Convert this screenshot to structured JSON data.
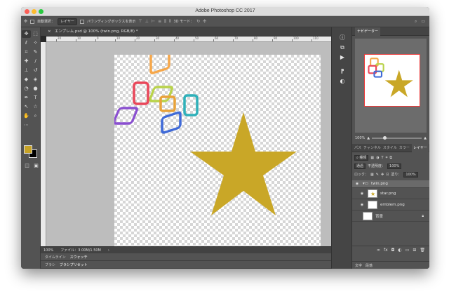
{
  "window": {
    "title": "Adobe Photoshop CC 2017"
  },
  "options_bar": {
    "auto_select_label": "自動選択：",
    "auto_select_value": "レイヤー",
    "transform_controls_label": "バウンディングボックスを表示",
    "mode_3d_label": "3D モード："
  },
  "document": {
    "tab_title": "エンブレム.psd @ 100% (twin.png, RGB/8) *",
    "ruler_ticks": [
      "20",
      "10",
      "0",
      "10",
      "20",
      "30",
      "40",
      "50",
      "60",
      "70",
      "80",
      "90",
      "100",
      "110",
      "120"
    ],
    "zoom": "100%",
    "file_info": "ファイル：3.00M/1.50M"
  },
  "bottom_panels": {
    "row1": [
      "タイムライン",
      "スウォッチ"
    ],
    "row2": [
      "ブラシ",
      "ブラシプリセット"
    ]
  },
  "navigator": {
    "tab": "ナビゲーター",
    "zoom": "100%"
  },
  "layers_panel": {
    "tabs": [
      "パス",
      "チャンネル",
      "スタイル",
      "カラー",
      "レイヤー"
    ],
    "filter_label": "種類",
    "blend_mode": "通過",
    "opacity_label": "不透明度：",
    "opacity_value": "100%",
    "lock_label": "ロック：",
    "fill_label": "塗り：",
    "fill_value": "100%",
    "layers": [
      {
        "name": "twin.png",
        "type": "group"
      },
      {
        "name": "star.png",
        "type": "layer"
      },
      {
        "name": "emblem.png",
        "type": "layer"
      },
      {
        "name": "背景",
        "type": "background"
      }
    ]
  },
  "right_bottom_tabs": [
    "文字",
    "段落"
  ],
  "colors": {
    "star": "#c9a727",
    "foreground": "#c7a326",
    "background": "#000000",
    "nav_frame": "#ec3a3a"
  }
}
